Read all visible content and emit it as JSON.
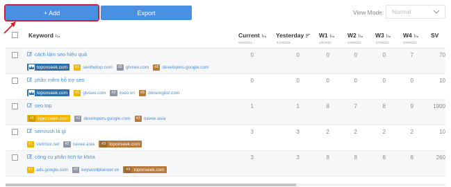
{
  "toolbar": {
    "add_label": "+ Add",
    "export_label": "Export",
    "view_mode_label": "View Mode:",
    "view_mode_value": "Normal"
  },
  "header": {
    "keyword": "Keyword",
    "current": "Current",
    "current_date": "5/10/2021",
    "yesterday": "Yesterday",
    "yesterday_date": "4/10/2021",
    "w1": "W1",
    "w1_date": "1/9/2021",
    "w2": "W2",
    "w2_date": "24/9/2021",
    "w3": "W3",
    "w3_date": "17/9/2021",
    "w4": "W4",
    "w4_date": "10/9/2021",
    "sv": "SV"
  },
  "rows": [
    {
      "keyword": "cách làm seo hiệu quả",
      "current": "0",
      "yesterday": "0",
      "w1": "0",
      "w2": "0",
      "w3": "0",
      "w4": "7",
      "sv": "70",
      "tags": [
        {
          "rank": "",
          "domain": "toponseek.com"
        },
        {
          "rank": "#1",
          "domain": "seothetop.com"
        },
        {
          "rank": "#2",
          "domain": "gtvseo.com"
        },
        {
          "rank": "#3",
          "domain": "developers.google.com"
        }
      ]
    },
    {
      "keyword": "phần mềm hỗ trợ seo",
      "current": "0",
      "yesterday": "0",
      "w1": "0",
      "w2": "0",
      "w3": "0",
      "w4": "0",
      "sv": "10",
      "tags": [
        {
          "rank": "",
          "domain": "toponseek.com"
        },
        {
          "rank": "#1",
          "domain": "gtvseo.com"
        },
        {
          "rank": "#2",
          "domain": "xseo.vn"
        },
        {
          "rank": "#3",
          "domain": "doisongbiz.com"
        }
      ]
    },
    {
      "keyword": "seo top",
      "current": "1",
      "yesterday": "1",
      "w1": "8",
      "w2": "7",
      "w3": "8",
      "w4": "9",
      "sv": "1900",
      "tags": [
        {
          "rank": "#1",
          "domain": "toponseek.com"
        },
        {
          "rank": "#2",
          "domain": "developers.google.com"
        },
        {
          "rank": "#3",
          "domain": "navee.asia"
        }
      ]
    },
    {
      "keyword": "semrush là gì",
      "current": "3",
      "yesterday": "3",
      "w1": "2",
      "w2": "2",
      "w3": "2",
      "w4": "2",
      "sv": "10",
      "tags": [
        {
          "rank": "#1",
          "domain": "vietmoz.net"
        },
        {
          "rank": "#2",
          "domain": "navee.asia"
        },
        {
          "rank": "#3",
          "domain": "toponseek.com"
        }
      ]
    },
    {
      "keyword": "công cụ phân tích từ khóa",
      "current": "3",
      "yesterday": "3",
      "w1": "8",
      "w2": "8",
      "w3": "8",
      "w4": "8",
      "sv": "260",
      "tags": [
        {
          "rank": "#1",
          "domain": "ads.google.com"
        },
        {
          "rank": "#2",
          "domain": "keywordplanner.vn"
        },
        {
          "rank": "#3",
          "domain": "toponseek.com"
        }
      ]
    }
  ]
}
